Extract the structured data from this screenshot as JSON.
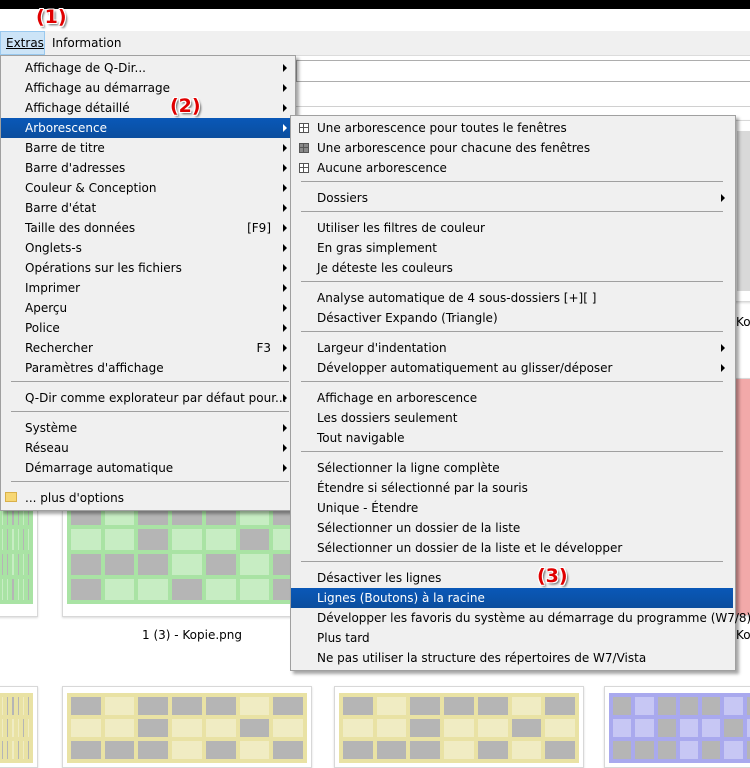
{
  "menubar": {
    "extras": "Extras",
    "information": "Information"
  },
  "badges": {
    "b1": "(1)",
    "b2": "(2)",
    "b3": "(3)"
  },
  "extras_menu": {
    "items": [
      {
        "label": "Affichage de Q-Dir...",
        "accel": "",
        "submenu": true
      },
      {
        "label": "Affichage au démarrage",
        "accel": "",
        "submenu": true
      },
      {
        "label": "Affichage détaillé",
        "accel": "",
        "submenu": true
      },
      {
        "label": "Arborescence",
        "accel": "",
        "submenu": true
      },
      {
        "label": "Barre de titre",
        "accel": "",
        "submenu": true
      },
      {
        "label": "Barre d'adresses",
        "accel": "",
        "submenu": true
      },
      {
        "label": "Couleur & Conception",
        "accel": "",
        "submenu": true
      },
      {
        "label": "Barre d'état",
        "accel": "",
        "submenu": true
      },
      {
        "label": "Taille des données",
        "accel": "[F9]",
        "submenu": true
      },
      {
        "label": "Onglets-s",
        "accel": "",
        "submenu": true
      },
      {
        "label": "Opérations sur les fichiers",
        "accel": "",
        "submenu": true
      },
      {
        "label": "Imprimer",
        "accel": "",
        "submenu": true
      },
      {
        "label": "Aperçu",
        "accel": "",
        "submenu": true
      },
      {
        "label": "Police",
        "accel": "",
        "submenu": true
      },
      {
        "label": "Rechercher",
        "accel": "F3",
        "submenu": true
      },
      {
        "label": "Paramètres d'affichage",
        "accel": "",
        "submenu": true
      },
      {
        "label": "Q-Dir comme explorateur par défaut pour...",
        "accel": "",
        "submenu": true
      },
      {
        "label": "Système",
        "accel": "",
        "submenu": true
      },
      {
        "label": "Réseau",
        "accel": "",
        "submenu": true
      },
      {
        "label": "Démarrage automatique",
        "accel": "",
        "submenu": true
      },
      {
        "label": "... plus d'options",
        "accel": "",
        "submenu": false
      }
    ]
  },
  "tree_menu": {
    "items": [
      "Une arborescence pour toutes le fenêtres",
      "Une arborescence pour chacune des fenêtres",
      "Aucune arborescence",
      "Dossiers",
      "Utiliser les filtres de couleur",
      "En gras simplement",
      "Je déteste les couleurs",
      "Analyse automatique de 4 sous-dossiers [+][ ]",
      "Désactiver Expando (Triangle)",
      "Largeur d'indentation",
      "Développer automatiquement au glisser/déposer",
      "Affichage en arborescence",
      "Les dossiers seulement",
      "Tout navigable",
      "Sélectionner la ligne complète",
      "Étendre si sélectionné par la souris",
      "Unique - Étendre",
      "Sélectionner un dossier de la liste",
      "Sélectionner un dossier de la liste et le développer",
      "Désactiver les lignes",
      "Lignes (Boutons) à la racine",
      "Développer les favoris du système au démarrage du programme (W7/8)",
      "Plus tard",
      "Ne pas utiliser la structure des répertoires de W7/Vista"
    ]
  },
  "thumbnails": {
    "caption_main": "1 (3) - Kopie.png",
    "caption_right_1": "Ko",
    "caption_right_2": "Ko"
  },
  "colors": {
    "highlight": "#0b58b0",
    "thumb_green": "#a9e3a4",
    "thumb_red": "#f2a9a9",
    "thumb_yellow": "#e9e2a4",
    "thumb_blue": "#a9a9ee",
    "cell_gray": "#b5b5b5"
  }
}
